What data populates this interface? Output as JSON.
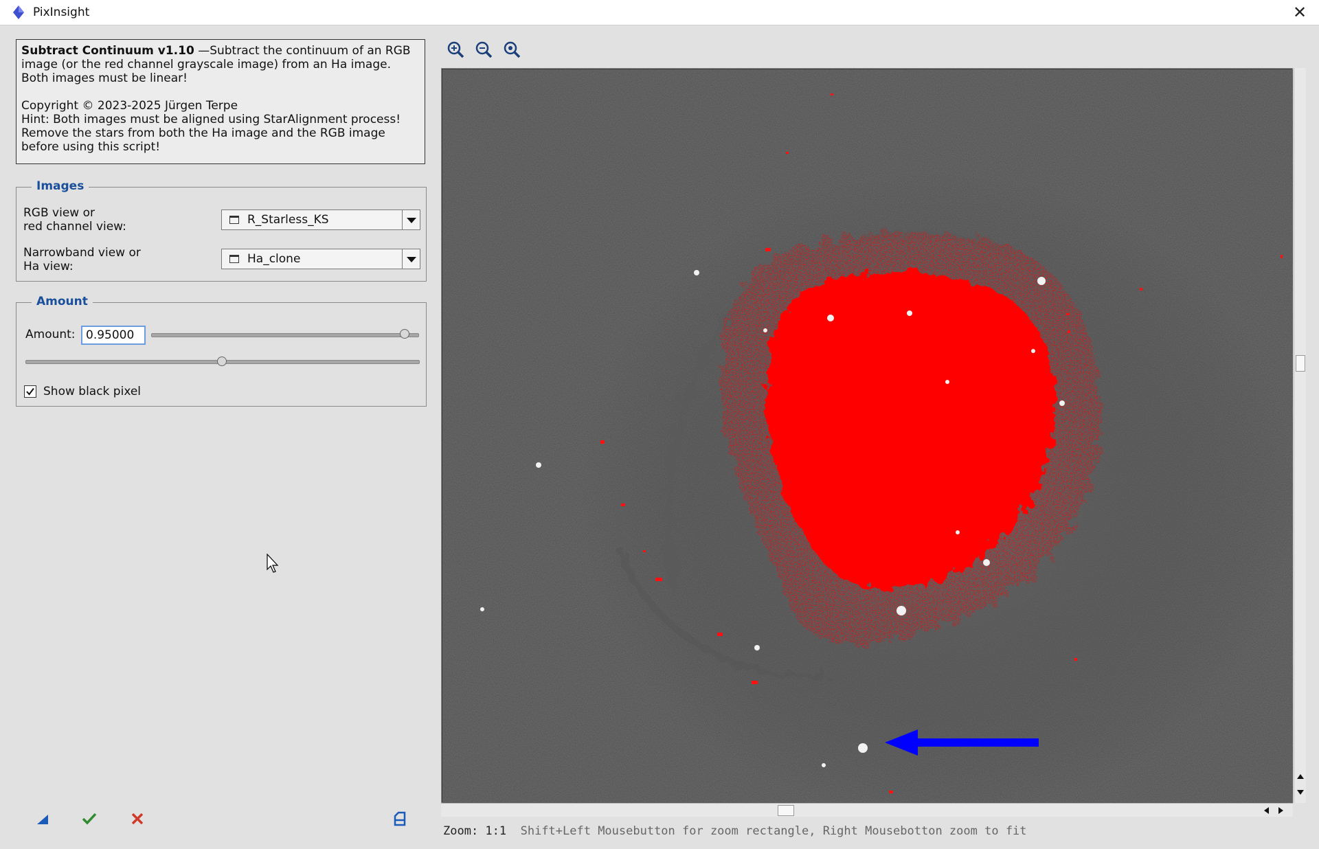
{
  "window": {
    "title": "PixInsight",
    "close_glyph": "✕"
  },
  "info": {
    "script_name": "Subtract Continuum v1.10",
    "description": " —Subtract the continuum of an RGB image (or the red channel grayscale image) from an Ha image. Both images must be linear!",
    "copyright": "Copyright © 2023-2025 Jürgen Terpe",
    "hint_line1": "Hint: Both images must be aligned using StarAlignment process!",
    "hint_line2": "Remove the stars from both the Ha image and the RGB image before using this script!"
  },
  "images_group": {
    "title": "Images",
    "rgb_label_1": "RGB view or",
    "rgb_label_2": "red channel view:",
    "rgb_value": "R_Starless_KS",
    "nb_label_1": "Narrowband view or",
    "nb_label_2": "Ha view:",
    "nb_value": "Ha_clone"
  },
  "amount_group": {
    "title": "Amount",
    "amount_label": "Amount:",
    "amount_value": "0.95000",
    "amount_slider_fraction": 0.95,
    "second_slider_fraction": 0.5,
    "show_black_label": "Show black pixel",
    "show_black_checked": true
  },
  "bottom_buttons": {
    "new_instance_icon": "triangle-icon",
    "ok_icon": "check-icon",
    "cancel_icon": "x-icon",
    "reset_icon": "document-icon"
  },
  "preview_toolbar": {
    "zoom_in_icon": "zoom-in-icon",
    "zoom_out_icon": "zoom-out-icon",
    "zoom_fit_icon": "zoom-fit-icon"
  },
  "status": {
    "zoom_text": "Zoom: 1:1",
    "hint": "Shift+Left Mousebutton for zoom rectangle, Right Mousebotton zoom to fit"
  },
  "colors": {
    "accent": "#1a4f9c",
    "nebula_red": "#ff0000",
    "arrow_blue": "#0000ff",
    "ok_green": "#2e8b2e",
    "cancel_red": "#d03a2a"
  }
}
